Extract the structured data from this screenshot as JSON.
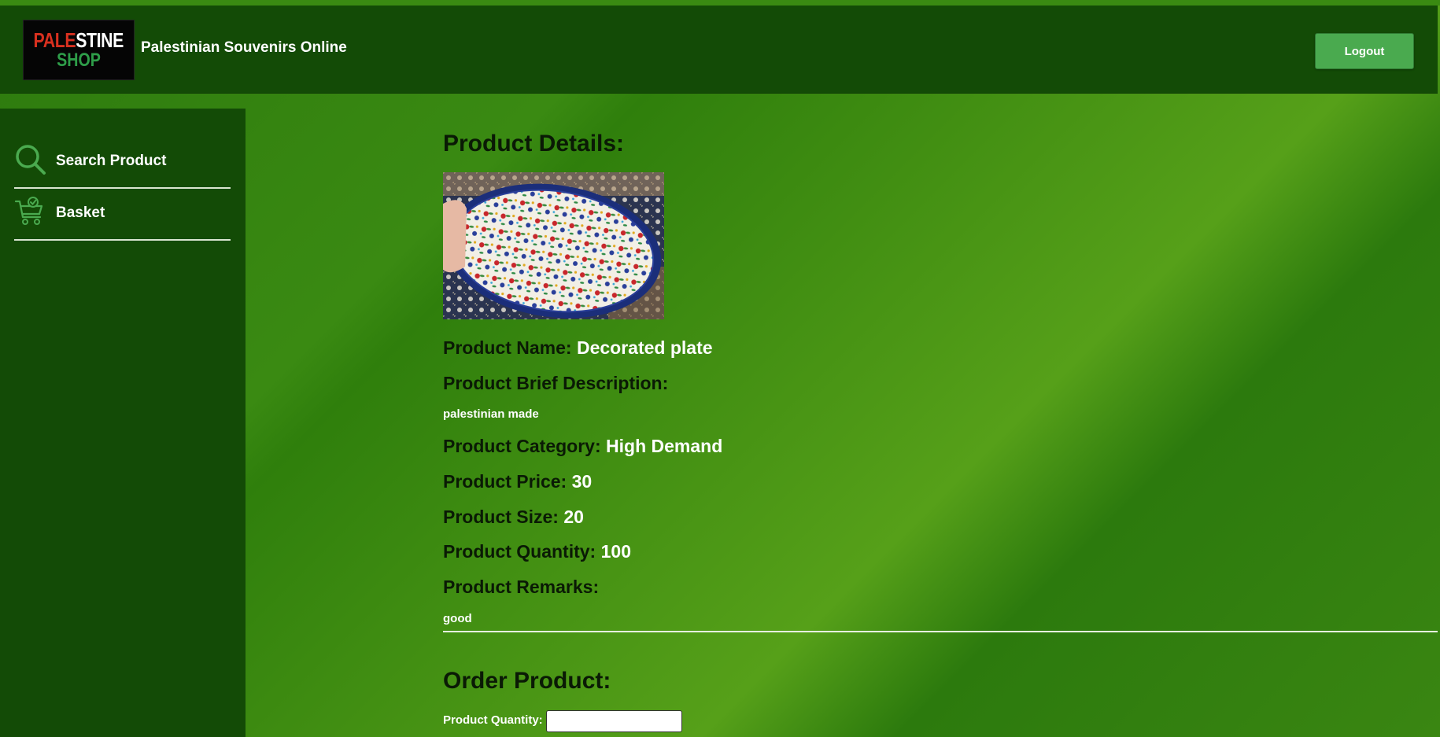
{
  "header": {
    "logo": {
      "top_left": "PALE",
      "top_right": "STINE",
      "bottom": "SHOP"
    },
    "site_title": "Palestinian Souvenirs Online",
    "logout_label": "Logout"
  },
  "sidebar": {
    "items": [
      {
        "label": "Search Product",
        "icon": "search-icon"
      },
      {
        "label": "Basket",
        "icon": "basket-icon"
      }
    ]
  },
  "product": {
    "section_title": "Product Details:",
    "name_label": "Product Name:",
    "name": "Decorated plate",
    "description_label": "Product Brief Description:",
    "description": "palestinian made",
    "category_label": "Product Category:",
    "category": "High Demand",
    "price_label": "Product Price:",
    "price": "30",
    "size_label": "Product Size:",
    "size": "20",
    "quantity_label": "Product Quantity:",
    "quantity": "100",
    "remarks_label": "Product Remarks:",
    "remarks": "good"
  },
  "order": {
    "section_title": "Order Product:",
    "quantity_label": "Product Quantity:",
    "quantity_value": ""
  },
  "colors": {
    "header_bg": "#134b06",
    "sidebar_bg": "#134b06",
    "logout_bg": "#4aaa4f",
    "icon_green": "#4aaa4f"
  }
}
